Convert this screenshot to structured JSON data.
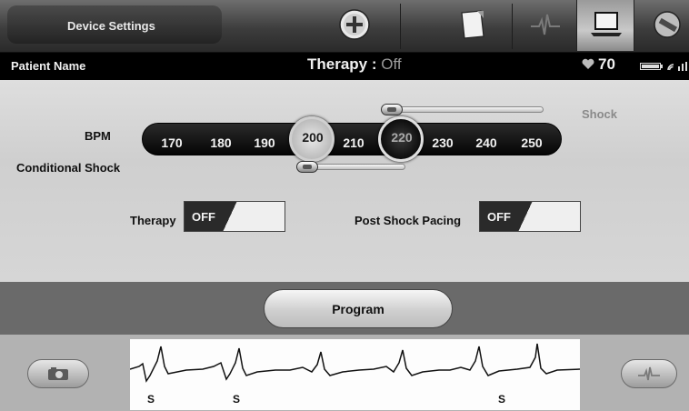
{
  "header": {
    "title": "Device Settings",
    "tabs": [
      {
        "icon": "plus-circle-icon"
      },
      {
        "icon": "document-icon"
      },
      {
        "icon": "ecg-waveform-icon"
      },
      {
        "icon": "laptop-icon",
        "active": true
      },
      {
        "icon": "wand-icon"
      }
    ]
  },
  "status": {
    "patient_label": "Patient Name",
    "therapy_label": "Therapy :",
    "therapy_value": "Off",
    "heart_rate": "70"
  },
  "settings": {
    "shock_label": "Shock",
    "bpm_label": "BPM",
    "conditional_shock_label": "Conditional Shock",
    "bpm_ticks": [
      "170",
      "180",
      "190",
      "200",
      "210",
      "220",
      "230",
      "240",
      "250"
    ],
    "conditional_shock_bpm": "200",
    "shock_bpm": "220",
    "therapy_toggle": {
      "label": "Therapy",
      "value": "OFF"
    },
    "post_shock_pacing_toggle": {
      "label": "Post Shock Pacing",
      "value": "OFF"
    }
  },
  "program": {
    "label": "Program"
  },
  "ecg": {
    "beat_markers": [
      "S",
      "S",
      "S"
    ]
  },
  "colors": {
    "scale_background": "#000000",
    "panel_background": "#d4d4d4",
    "band_background": "#6a6a6a"
  }
}
